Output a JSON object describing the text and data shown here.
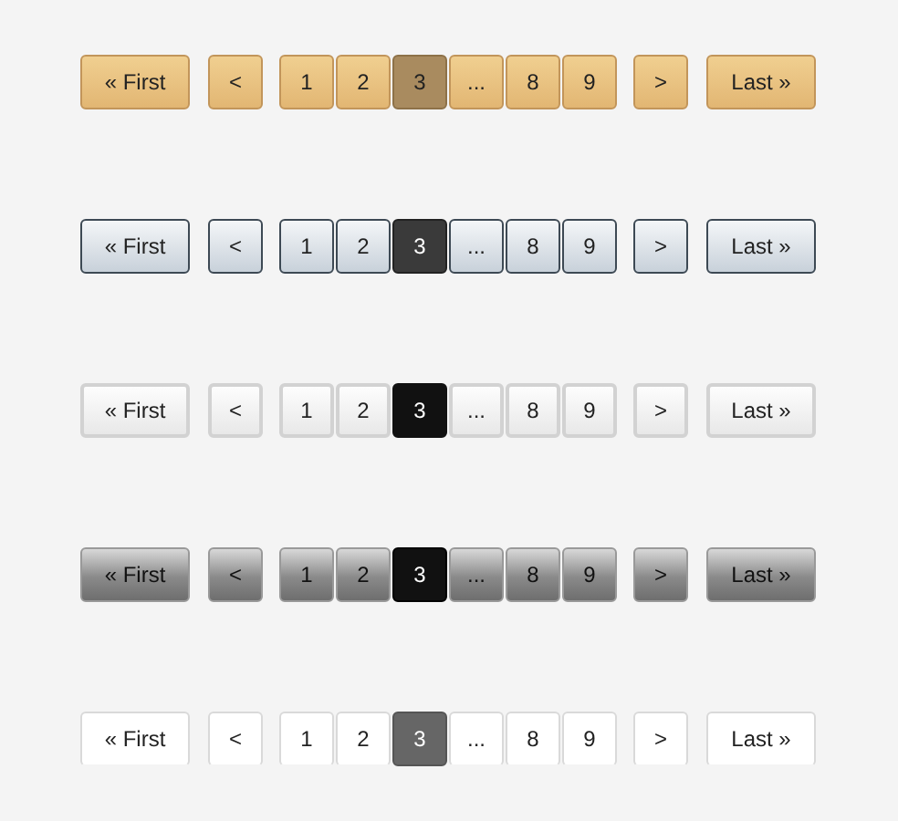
{
  "paginations": [
    {
      "kind": "wood",
      "first": "« First",
      "prev": "<",
      "pages": [
        {
          "label": "1",
          "selected": false
        },
        {
          "label": "2",
          "selected": false
        },
        {
          "label": "3",
          "selected": true
        },
        {
          "label": "...",
          "selected": false
        },
        {
          "label": "8",
          "selected": false
        },
        {
          "label": "9",
          "selected": false
        }
      ],
      "next": ">",
      "last": "Last »"
    },
    {
      "kind": "steel",
      "first": "« First",
      "prev": "<",
      "pages": [
        {
          "label": "1",
          "selected": false
        },
        {
          "label": "2",
          "selected": false
        },
        {
          "label": "3",
          "selected": true
        },
        {
          "label": "...",
          "selected": false
        },
        {
          "label": "8",
          "selected": false
        },
        {
          "label": "9",
          "selected": false
        }
      ],
      "next": ">",
      "last": "Last »"
    },
    {
      "kind": "light",
      "first": "« First",
      "prev": "<",
      "pages": [
        {
          "label": "1",
          "selected": false
        },
        {
          "label": "2",
          "selected": false
        },
        {
          "label": "3",
          "selected": true
        },
        {
          "label": "...",
          "selected": false
        },
        {
          "label": "8",
          "selected": false
        },
        {
          "label": "9",
          "selected": false
        }
      ],
      "next": ">",
      "last": "Last »"
    },
    {
      "kind": "dark",
      "first": "« First",
      "prev": "<",
      "pages": [
        {
          "label": "1",
          "selected": false
        },
        {
          "label": "2",
          "selected": false
        },
        {
          "label": "3",
          "selected": true
        },
        {
          "label": "...",
          "selected": false
        },
        {
          "label": "8",
          "selected": false
        },
        {
          "label": "9",
          "selected": false
        }
      ],
      "next": ">",
      "last": "Last »"
    },
    {
      "kind": "plain",
      "first": "« First",
      "prev": "<",
      "pages": [
        {
          "label": "1",
          "selected": false
        },
        {
          "label": "2",
          "selected": false
        },
        {
          "label": "3",
          "selected": true
        },
        {
          "label": "...",
          "selected": false
        },
        {
          "label": "8",
          "selected": false
        },
        {
          "label": "9",
          "selected": false
        }
      ],
      "next": ">",
      "last": "Last »"
    }
  ]
}
